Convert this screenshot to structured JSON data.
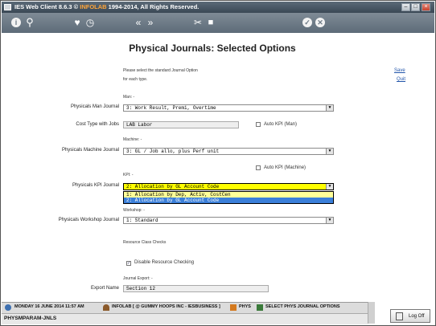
{
  "window": {
    "title_prefix": "IES Web Client 8.6.3 © ",
    "title_brand": "INFOLAB",
    "title_suffix": " 1994-2014, All Rights Reserved.",
    "minimize": "–",
    "maximize": "□",
    "close": "×"
  },
  "toolbar": {
    "info": "i",
    "search": "⚲",
    "favorite": "♥",
    "history": "◷",
    "prev": "«",
    "next": "»",
    "tools": "✂",
    "stop": "■",
    "ok": "✓",
    "cancel": "✕"
  },
  "page": {
    "title": "Physical Journals: Selected Options",
    "intro_line1": "Please select the standard Journal Option",
    "intro_line2": "for each type.",
    "save_link": "Save",
    "quit_link": "Quit"
  },
  "form": {
    "man_section": "Man: -",
    "man_journal_label": "Physicals Man Journal",
    "man_journal_value": "3: Work Result, Premi, Overtime",
    "cost_type_label": "Cost Type with Jobs",
    "cost_type_value": "LAB Labor",
    "auto_kpi_man_label": "Auto KPI (Man)",
    "machine_section": "Machine: -",
    "machine_journal_label": "Physicals Machine Journal",
    "machine_journal_value": "3: GL / Job allo, plus Perf unit",
    "auto_kpi_machine_label": "Auto KPI (Machine)",
    "kpi_section": "KPI: -",
    "kpi_journal_label": "Physicals KPI Journal",
    "kpi_journal_value": "2: Allocation by GL Account Code",
    "kpi_options": [
      "1: Allocation by Dep, Activ, CostCen",
      "2: Allocation by GL Account Code"
    ],
    "workshop_section": "Workshop: -",
    "workshop_journal_label": "Physicals Workshop Journal",
    "workshop_journal_value": "1: Standard",
    "resource_class_label": "Resource Class Checks",
    "disable_resource_label": "Disable Resource Checking",
    "disable_resource_checked": true,
    "journal_export_label": "Journal Export: -",
    "export_name_label": "Export Name",
    "export_name_value": "Section 12"
  },
  "statusbar": {
    "date": "Monday 16 June 2014 11:57 AM",
    "company": "Infolab [ @ Gummy Hoops Inc - IESbusiness ]",
    "module": "Phys",
    "screen": "Select Phys Journal Options",
    "program_code": "PHYSMPARAM-JNLS",
    "logoff": "Log Off"
  },
  "colors": {
    "kpi_highlight": "#ffff00",
    "dropdown_selected": "#3b7fd9",
    "link": "#2255aa",
    "brand": "#ffa53a"
  }
}
